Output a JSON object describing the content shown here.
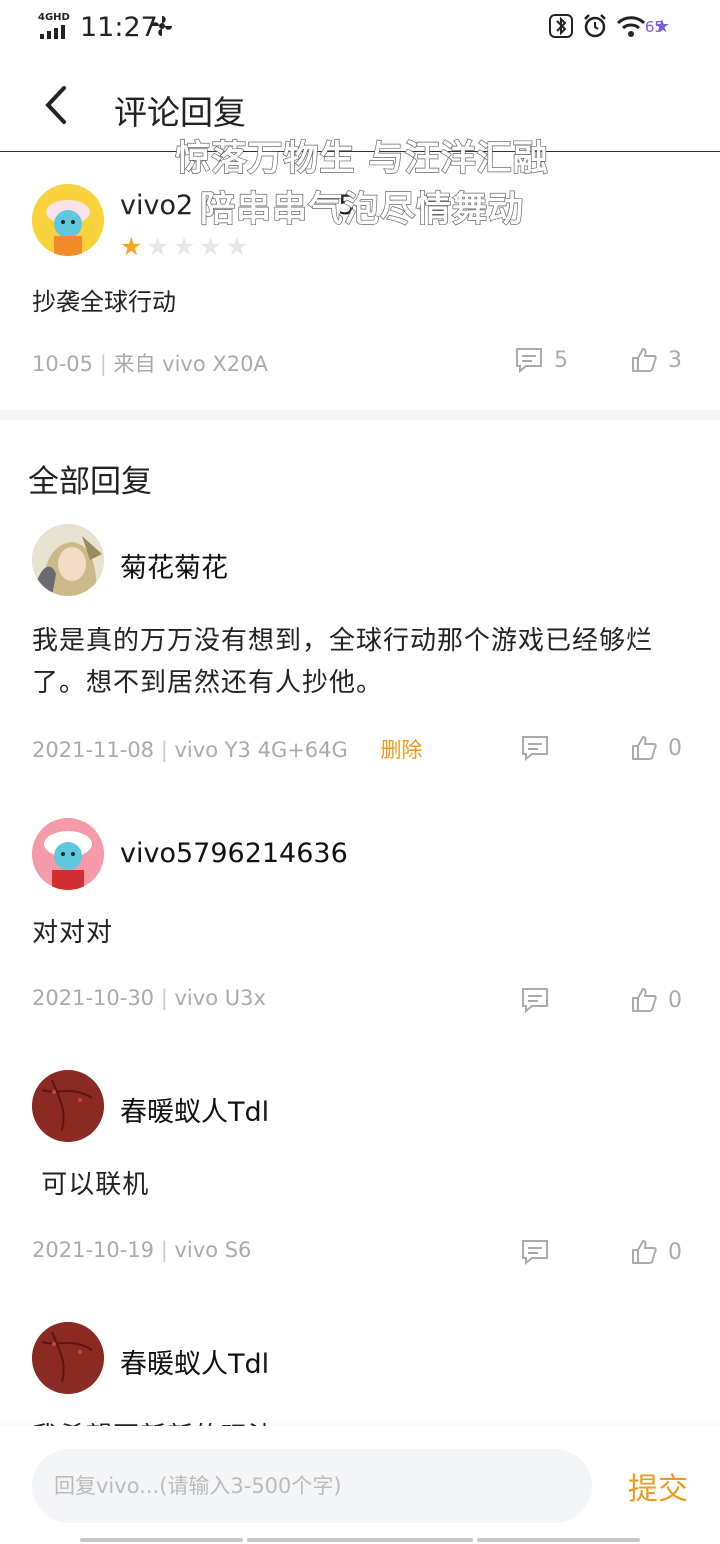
{
  "status_bar": {
    "network": "4GHD",
    "time": "11:27",
    "battery": "65"
  },
  "header": {
    "title": "评论回复"
  },
  "lyrics": {
    "line1": "惊落万物生 与汪洋汇融",
    "line2": "陪串串气泡尽情舞动"
  },
  "main_comment": {
    "username": "vivo2",
    "username_tail": "5",
    "rating": 1,
    "rating_max": 5,
    "text": "抄袭全球行动",
    "date": "10-05",
    "source": "来自 vivo X20A",
    "comments": "5",
    "likes": "3"
  },
  "section": {
    "title": "全部回复"
  },
  "replies": [
    {
      "username": "菊花菊花",
      "text": "我是真的万万没有想到，全球行动那个游戏已经够烂了。想不到居然还有人抄他。",
      "date": "2021-11-08",
      "device": "vivo Y3 4G+64G",
      "delete_label": "删除",
      "likes": "0"
    },
    {
      "username": "vivo5796214636",
      "text": "对对对",
      "date": "2021-10-30",
      "device": "vivo U3x",
      "likes": "0"
    },
    {
      "username": "春暖蚁人Tdl",
      "text": " 可以联机",
      "date": "2021-10-19",
      "device": "vivo S6",
      "likes": "0"
    },
    {
      "username": "春暖蚁人Tdl",
      "text": "我希望更新新的玩法"
    }
  ],
  "input": {
    "placeholder": "回复vivo...(请输入3-500个字)",
    "submit_label": "提交"
  },
  "colors": {
    "accent": "#f09a1a",
    "star": "#f5a623",
    "muted": "#aaaaaa"
  }
}
